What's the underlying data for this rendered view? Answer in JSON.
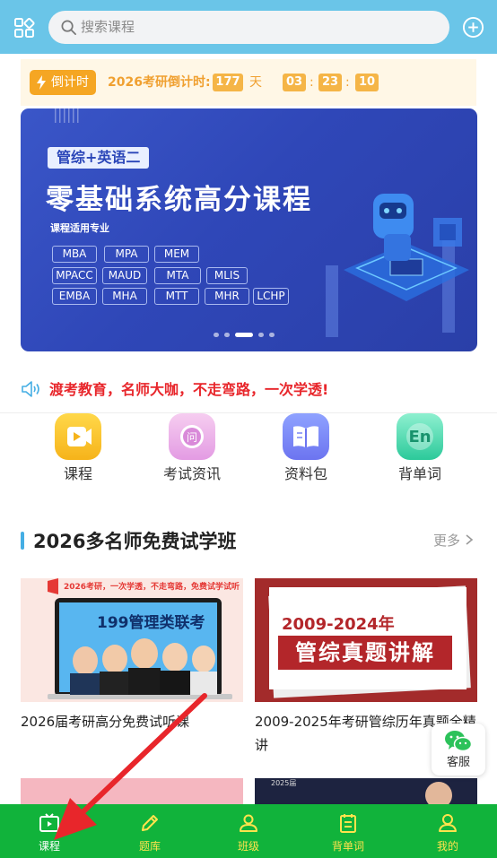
{
  "header": {
    "search_placeholder": "搜索课程"
  },
  "countdown": {
    "badge": "倒计时",
    "label": "2026考研倒计时:",
    "days": "177",
    "days_unit": "天",
    "hours": "03",
    "minutes": "23",
    "seconds": "10",
    "sep": ":"
  },
  "banner": {
    "tag": "管综+英语二",
    "title": "零基础系统高分课程",
    "subtitle": "课程适用专业",
    "majors": [
      "MBA",
      "MPA",
      "MEM",
      "MPACC",
      "MAUD",
      "MTA",
      "MLIS",
      "EMBA",
      "MHA",
      "MTT",
      "MHR",
      "LCHP"
    ],
    "slides": 5,
    "active_slide": 3
  },
  "slogan": "渡考教育，名师大咖，不走弯路，一次学透!",
  "quick_nav": [
    {
      "label": "课程",
      "icon": "video-icon"
    },
    {
      "label": "考试资讯",
      "icon": "question-icon"
    },
    {
      "label": "资料包",
      "icon": "book-icon"
    },
    {
      "label": "背单词",
      "icon": "en-icon"
    }
  ],
  "section": {
    "title": "2026多名师免费试学班",
    "more": "更多"
  },
  "cards": [
    {
      "title": "2026届考研高分免费试听课",
      "img_top": "2026考研，一次学透，不走弯路，免费试学试听",
      "img_main": "199管理类联考"
    },
    {
      "title": "2009-2025年考研管综历年真题全精讲",
      "img_year": "2009-2024年",
      "img_main": "管综真题讲解"
    }
  ],
  "next_cards": {
    "badge": "2025届"
  },
  "kefu": "客服",
  "tabs": [
    {
      "label": "课程",
      "icon": "course-icon",
      "active": true
    },
    {
      "label": "题库",
      "icon": "pencil-icon",
      "active": false
    },
    {
      "label": "班级",
      "icon": "group-icon",
      "active": false
    },
    {
      "label": "背单词",
      "icon": "words-icon",
      "active": false
    },
    {
      "label": "我的",
      "icon": "user-icon",
      "active": false
    }
  ],
  "colors": {
    "header": "#6ac5e8",
    "tabbar": "#11b33b",
    "tab_active": "#ffffff",
    "tab_inactive": "#ffe34d",
    "accent": "#45aee4",
    "slogan": "#e8262b"
  }
}
